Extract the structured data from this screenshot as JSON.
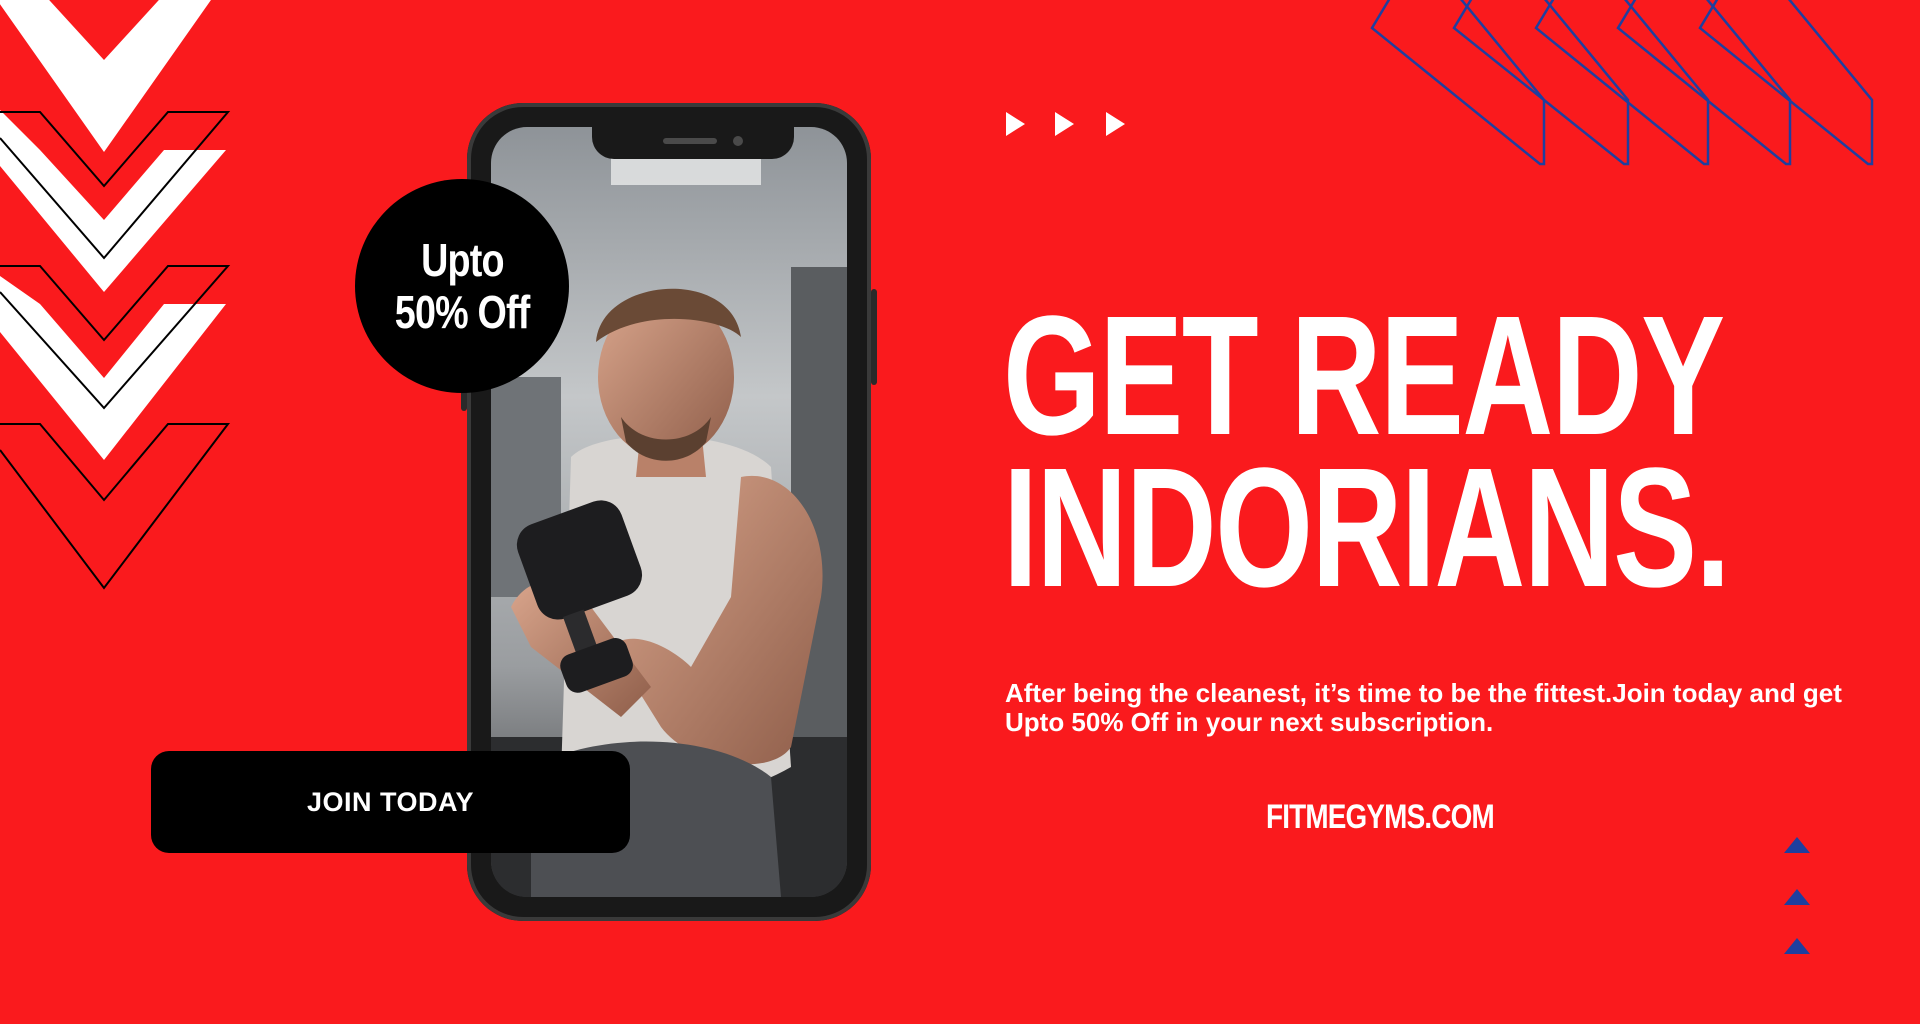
{
  "offer_badge": {
    "line1": "Upto",
    "line2": "50% Off"
  },
  "cta": {
    "join_label": "JOIN TODAY"
  },
  "headline": {
    "line1": "GET READY",
    "line2": "INDORIANS."
  },
  "body_text": "After being the cleanest, it’s time to be the fittest.Join today and get Upto 50% Off in your next subscription.",
  "website": "FITMEGYMS.COM",
  "colors": {
    "background": "#fa1a1d",
    "text": "#ffffff",
    "badge": "#000000",
    "accent_navy": "#1f3f9f"
  },
  "icons": [
    "chevron-down-icon",
    "play-arrow-icon",
    "triangle-up-icon",
    "chevron-left-outline-icon"
  ]
}
